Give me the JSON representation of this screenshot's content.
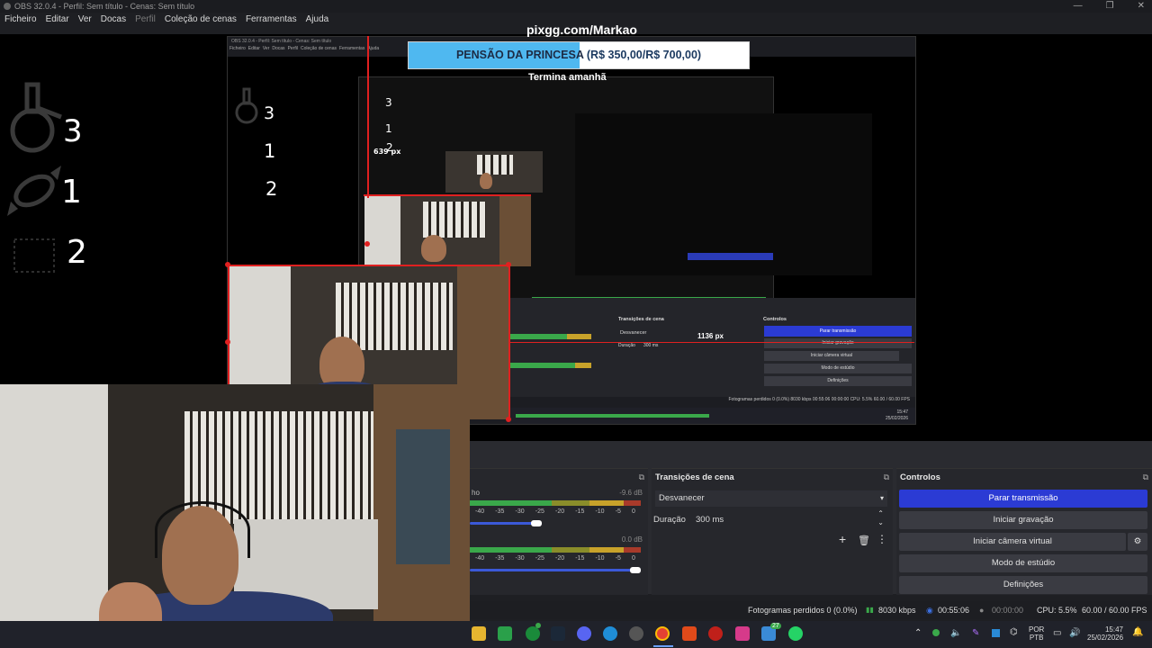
{
  "window": {
    "title": "OBS 32.0.4 - Perfil: Sem título - Cenas: Sem título",
    "controls": [
      "—",
      "❐",
      "✕"
    ]
  },
  "menu": [
    "Ficheiro",
    "Editar",
    "Ver",
    "Docas",
    "Perfil",
    "Coleção de cenas",
    "Ferramentas",
    "Ajuda"
  ],
  "overlay": {
    "url": "pixgg.com/Markao",
    "banner_title": "PENSÃO DA PRINCESA",
    "banner_amount": "(R$ 350,00/R$ 700,00)",
    "ghost_text": "Termina amanhã",
    "px_label_1": "639 px",
    "px_label_2": "1136 px"
  },
  "stats": {
    "large": [
      "3",
      "1",
      "2"
    ],
    "medium": [
      "3",
      "1",
      "2"
    ],
    "small": [
      "3",
      "1",
      "2"
    ]
  },
  "nested": {
    "title": "OBS 32.0.4 - Perfil: Sem título - Cenas: Sem título",
    "menu": [
      "Ficheiro",
      "Editar",
      "Ver",
      "Docas",
      "Perfil",
      "Coleção de cenas",
      "Ferramentas",
      "Ajuda"
    ],
    "transitions_header": "Transições de cena",
    "transition": "Desvanecer",
    "duration_label": "Duração",
    "duration": "300 ms",
    "controls_header": "Controlos",
    "buttons": [
      "Parar transmissão",
      "Iniciar gravação",
      "Iniciar câmera virtual",
      "Modo de estúdio",
      "Definições"
    ],
    "status": "Fotogramas perdidos 0 (0.0%)  8030 kbps  00:55:06  00:00:00  CPU: 5.5%  60.00 / 60.00 FPS",
    "clock": "15:47",
    "date": "25/02/2026"
  },
  "mixer": {
    "ch1_label": "ho",
    "ch1_db": "-9.6 dB",
    "ch1_level": 0.75,
    "ch2_db": "0.0 dB",
    "ch2_level": 1.0,
    "ticks": [
      "-40",
      "-35",
      "-30",
      "-25",
      "-20",
      "-15",
      "-10",
      "-5",
      "0"
    ]
  },
  "transitions": {
    "header": "Transições de cena",
    "menu_icon": "⧉",
    "selected": "Desvanecer",
    "duration_label": "Duração",
    "duration_value": "300 ms",
    "add_icon": "+",
    "delete_icon": "🗑",
    "more_icon": "⋮"
  },
  "controls": {
    "header": "Controlos",
    "stop_stream": "Parar transmissão",
    "start_recording": "Iniciar gravação",
    "start_virtual_cam": "Iniciar câmera virtual",
    "studio_mode": "Modo de estúdio",
    "settings": "Definições",
    "gear_icon": "⚙"
  },
  "statusbar": {
    "dropped": "Fotogramas perdidos 0 (0.0%)",
    "bitrate": "8030 kbps",
    "stream_time": "00:55:06",
    "rec_time": "00:00:00",
    "cpu": "CPU: 5.5%",
    "fps": "60.00 / 60.00 FPS"
  },
  "taskbar": {
    "lang_1": "POR",
    "lang_2": "PTB",
    "time": "15:47",
    "date": "25/02/2026",
    "badge": "27"
  },
  "colors": {
    "accent": "#2b3bd4",
    "banner_blue": "#4fb8f0",
    "red_guide": "#e02020",
    "meter_green": "#3aa84a",
    "meter_yellow": "#c8a22a"
  }
}
